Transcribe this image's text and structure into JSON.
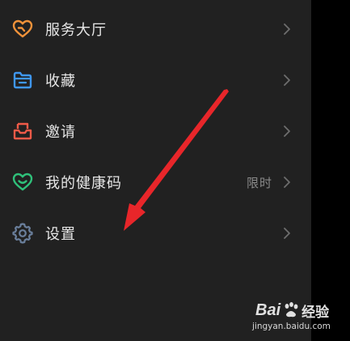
{
  "menu": {
    "items": [
      {
        "label": "服务大厅",
        "icon": "heart-outline-icon",
        "icon_color": "#f0923a",
        "extra": ""
      },
      {
        "label": "收藏",
        "icon": "folder-icon",
        "icon_color": "#3f97f0",
        "extra": ""
      },
      {
        "label": "邀请",
        "icon": "inbox-tray-icon",
        "icon_color": "#f05a48",
        "extra": ""
      },
      {
        "label": "我的健康码",
        "icon": "heart-smile-icon",
        "icon_color": "#2fc07a",
        "extra": "限时"
      },
      {
        "label": "设置",
        "icon": "gear-icon",
        "icon_color": "#6a7f9c",
        "extra": ""
      }
    ]
  },
  "annotation": {
    "arrow_color": "#e8262a"
  },
  "watermark": {
    "logo_text": "Bai",
    "logo_suffix": "经验",
    "url": "jingyan.baidu.com"
  }
}
